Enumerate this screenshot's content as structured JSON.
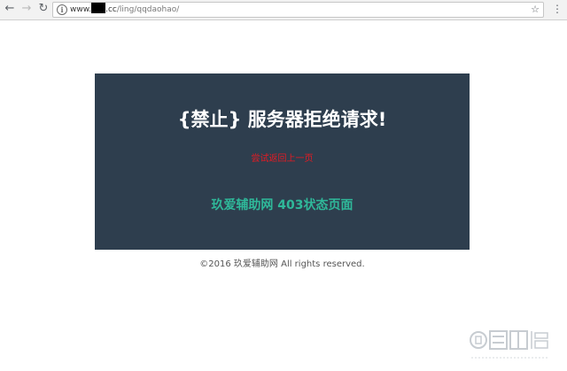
{
  "browser": {
    "back_icon": "arrow-left-icon",
    "forward_icon": "arrow-right-icon",
    "reload_icon": "reload-icon",
    "url_prefix": "www.",
    "url_suffix": ".cc",
    "url_path": "/ling/qqdaohao/"
  },
  "panel": {
    "title": "{禁止} 服务器拒绝请求!",
    "back_link": "尝试返回上一页",
    "site_code": "玖爱辅助网 403状态页面"
  },
  "footer": {
    "copyright": "©2016 玖爱辅助网 All rights reserved."
  },
  "colors": {
    "panel_bg": "#2e3e4e",
    "title": "#ffffff",
    "link": "#e41b23",
    "accent": "#2fb99a"
  }
}
